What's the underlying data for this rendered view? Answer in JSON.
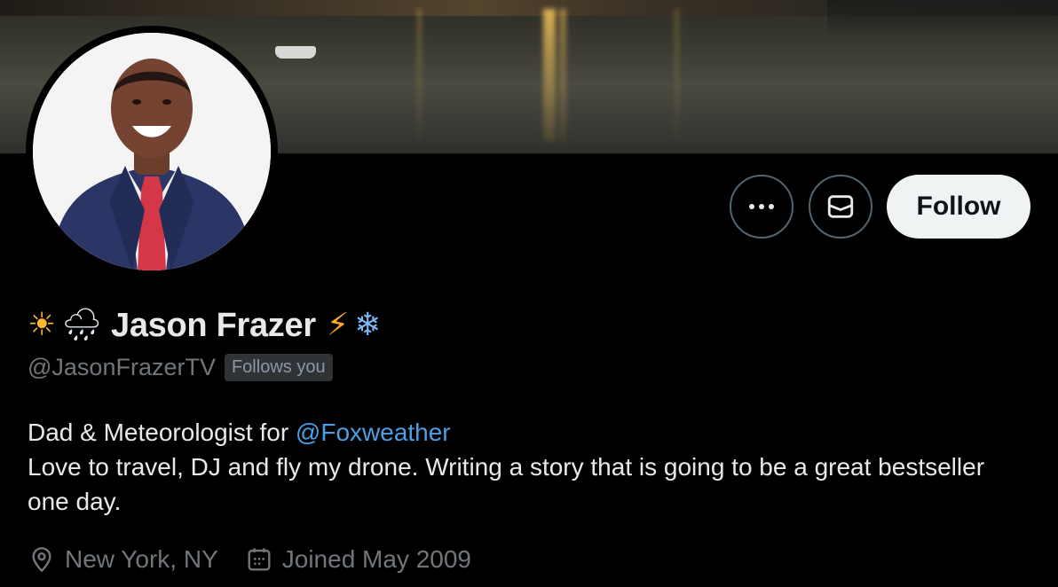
{
  "profile": {
    "name": "Jason Frazer",
    "handle": "@JasonFrazerTV",
    "follows_you": "Follows you",
    "name_prefix_emojis": [
      "☀",
      "🌧"
    ],
    "name_suffix_emojis": [
      "⚡",
      "❄"
    ],
    "bio": {
      "line1_prefix": "Dad & Meteorologist for ",
      "line1_mention": "@Foxweather",
      "line2": "Love to travel, DJ and fly my drone. Writing a story that is going to be a great bestseller one day."
    },
    "location": "New York, NY",
    "joined": "Joined May 2009"
  },
  "actions": {
    "follow_label": "Follow",
    "more_icon": "more-horizontal-icon",
    "message_icon": "envelope-icon"
  },
  "icons": {
    "location": "location-pin-icon",
    "joined": "calendar-icon"
  },
  "colors": {
    "background": "#000000",
    "text_primary": "#e7e9ea",
    "text_secondary": "#71767b",
    "link": "#4a9fe6",
    "follow_button_bg": "#eff3f4",
    "follow_button_text": "#0f1419",
    "badge_bg": "#2f3336"
  }
}
